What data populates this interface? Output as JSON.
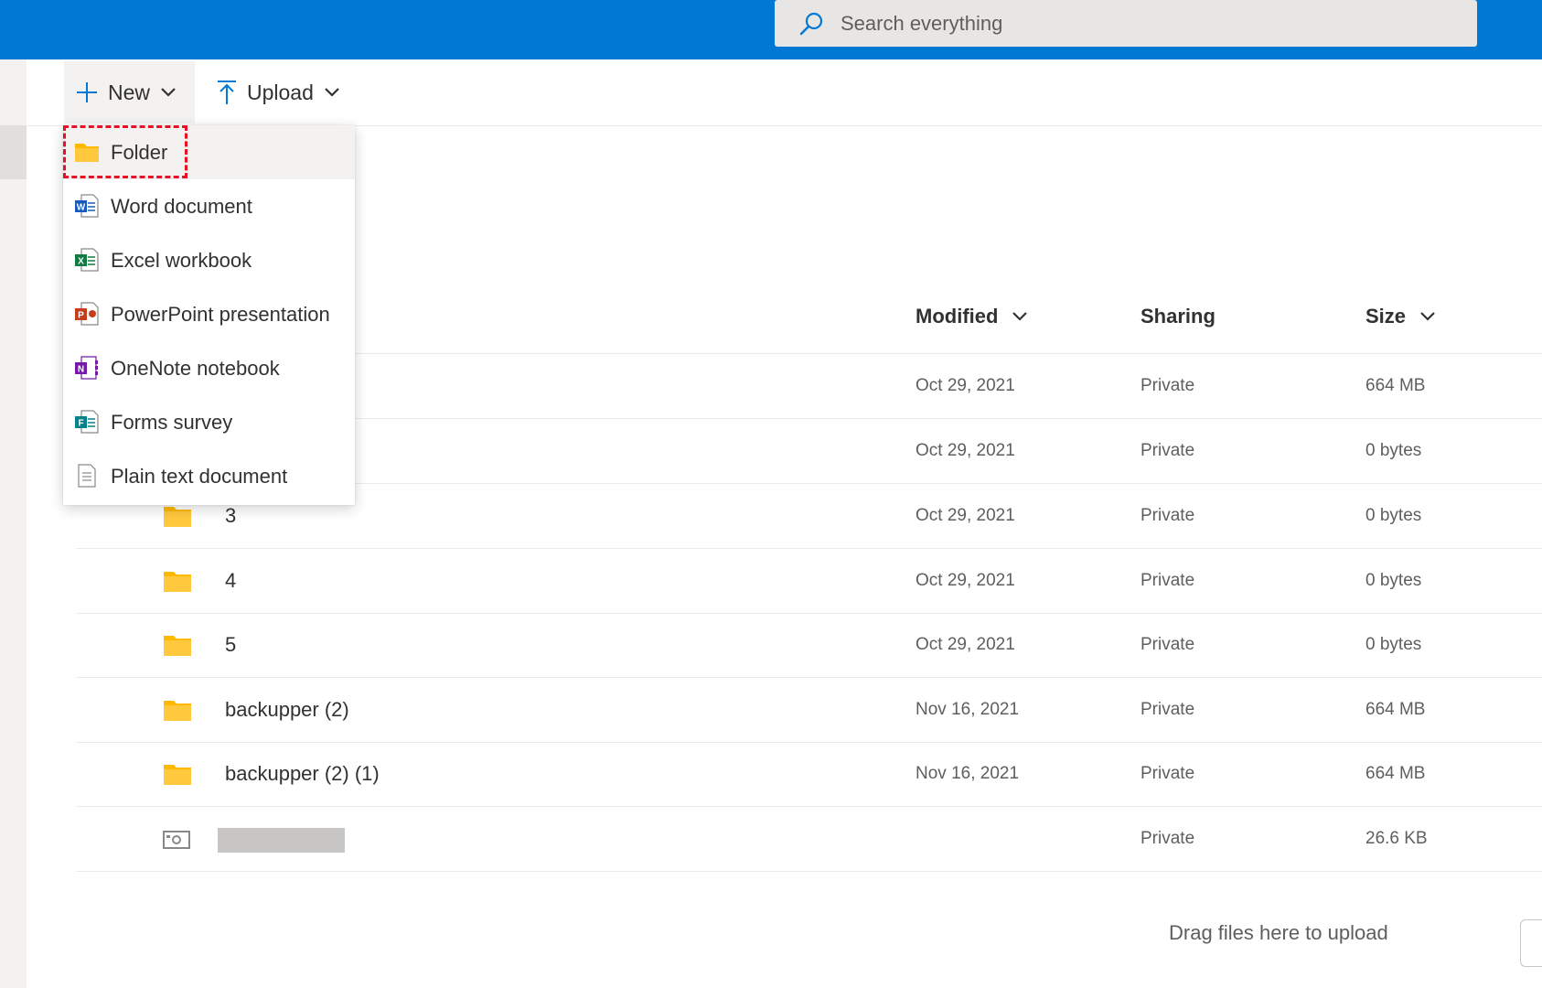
{
  "search": {
    "placeholder": "Search everything"
  },
  "commands": {
    "new_label": "New",
    "upload_label": "Upload"
  },
  "new_menu": [
    {
      "label": "Folder",
      "icon": "folder-icon"
    },
    {
      "label": "Word document",
      "icon": "word-icon"
    },
    {
      "label": "Excel workbook",
      "icon": "excel-icon"
    },
    {
      "label": "PowerPoint presentation",
      "icon": "powerpoint-icon"
    },
    {
      "label": "OneNote notebook",
      "icon": "onenote-icon"
    },
    {
      "label": "Forms survey",
      "icon": "forms-icon"
    },
    {
      "label": "Plain text document",
      "icon": "text-file-icon"
    }
  ],
  "columns": {
    "modified": "Modified",
    "sharing": "Sharing",
    "size": "Size"
  },
  "files": [
    {
      "name": "",
      "modified": "Oct 29, 2021",
      "sharing": "Private",
      "size": "664 MB"
    },
    {
      "name": "",
      "modified": "Oct 29, 2021",
      "sharing": "Private",
      "size": "0 bytes"
    },
    {
      "name": "3",
      "modified": "Oct 29, 2021",
      "sharing": "Private",
      "size": "0 bytes"
    },
    {
      "name": "4",
      "modified": "Oct 29, 2021",
      "sharing": "Private",
      "size": "0 bytes"
    },
    {
      "name": "5",
      "modified": "Oct 29, 2021",
      "sharing": "Private",
      "size": "0 bytes"
    },
    {
      "name": "backupper (2)",
      "modified": "Nov 16, 2021",
      "sharing": "Private",
      "size": "664 MB"
    },
    {
      "name": "backupper (2) (1)",
      "modified": "Nov 16, 2021",
      "sharing": "Private",
      "size": "664 MB"
    },
    {
      "name": "",
      "modified": "",
      "sharing": "Private",
      "size": "26.6 KB"
    }
  ],
  "dropzone": {
    "label": "Drag files here to upload"
  },
  "colors": {
    "brand": "#0078d4",
    "folder": "#ffb900",
    "highlight": "#e81123"
  }
}
